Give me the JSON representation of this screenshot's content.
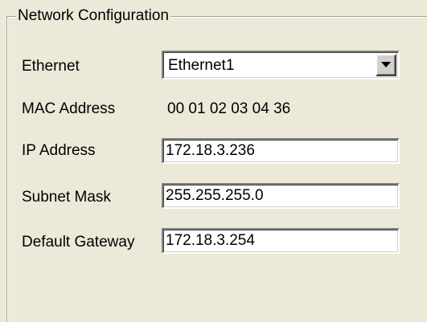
{
  "group": {
    "title": "Network Configuration"
  },
  "ethernet": {
    "label": "Ethernet",
    "selected": "Ethernet1"
  },
  "mac": {
    "label": "MAC Address",
    "value": "00 01 02 03 04 36"
  },
  "ip": {
    "label": "IP Address",
    "value": "172.18.3.236"
  },
  "subnet": {
    "label": "Subnet Mask",
    "value": "255.255.255.0"
  },
  "gateway": {
    "label": "Default Gateway",
    "value": "172.18.3.254"
  },
  "icons": {
    "dropdown": "chevron-down-icon"
  }
}
